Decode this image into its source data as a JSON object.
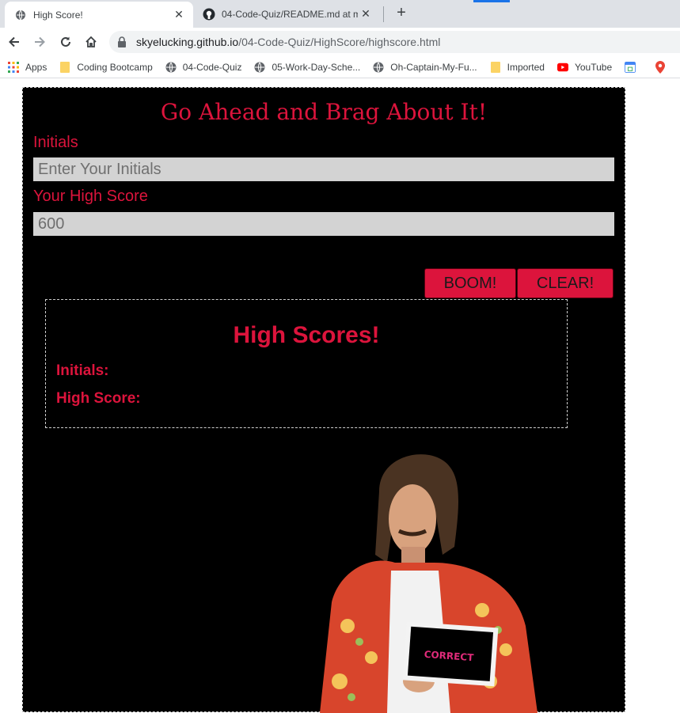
{
  "browser": {
    "tabs": [
      {
        "title": "High Score!",
        "active": true
      },
      {
        "title": "04-Code-Quiz/README.md at m",
        "active": false
      }
    ],
    "url_host": "skyelucking.github.io",
    "url_path": "/04-Code-Quiz/HighScore/highscore.html",
    "bookmarks": [
      {
        "label": "Apps",
        "icon": "apps-grid-icon"
      },
      {
        "label": "Coding Bootcamp",
        "icon": "folder-icon"
      },
      {
        "label": "04-Code-Quiz",
        "icon": "globe-icon"
      },
      {
        "label": "05-Work-Day-Sche...",
        "icon": "globe-icon"
      },
      {
        "label": "Oh-Captain-My-Fu...",
        "icon": "globe-icon"
      },
      {
        "label": "Imported",
        "icon": "folder-icon"
      },
      {
        "label": "YouTube",
        "icon": "youtube-icon"
      }
    ],
    "colors": {
      "accent": "#1a73e8",
      "tabstrip": "#dee1e6"
    }
  },
  "page": {
    "heading": "Go Ahead and Brag About It!",
    "initials_label": "Initials",
    "initials_placeholder": "Enter Your Initials",
    "score_label": "Your High Score",
    "score_value": "600",
    "boom_button": "BOOM!",
    "clear_button": "CLEAR!",
    "scores_title": "High Scores!",
    "scores_initials_label": "Initials:",
    "scores_highscore_label": "High Score:",
    "photo_sign_text": "CORRECT",
    "colors": {
      "accent": "#dc143c",
      "background": "#000000",
      "field": "#d3d3d3"
    }
  }
}
